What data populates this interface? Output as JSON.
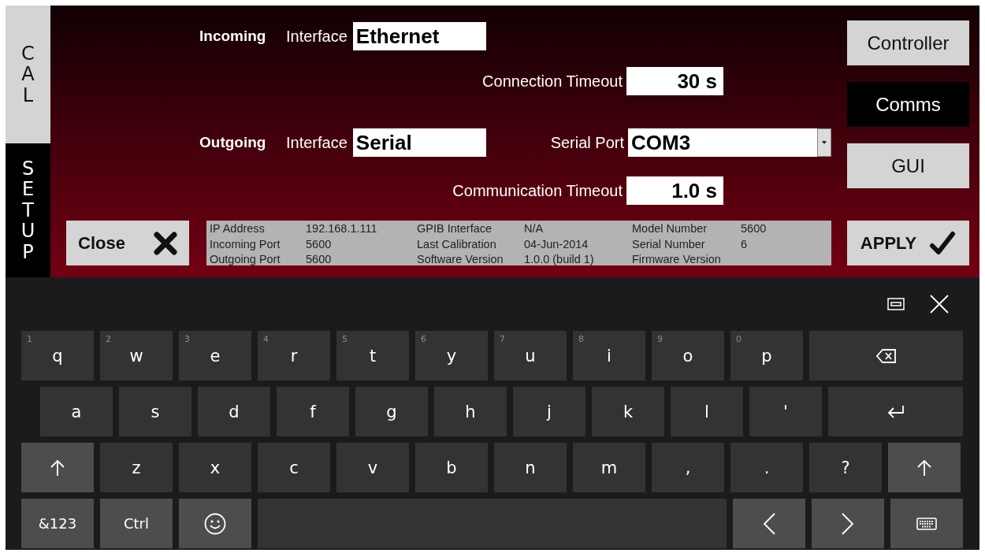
{
  "side_tabs": [
    {
      "label": "CAL",
      "selected": false
    },
    {
      "label": "SETUP",
      "selected": true
    }
  ],
  "incoming": {
    "heading": "Incoming",
    "interface_label": "Interface",
    "interface": "Ethernet",
    "timeout_label": "Connection Timeout",
    "timeout": "30 s"
  },
  "outgoing": {
    "heading": "Outgoing",
    "interface_label": "Interface",
    "interface": "Serial",
    "port_label": "Serial Port",
    "port": "COM3",
    "timeout_label": "Communication Timeout",
    "timeout": "1.0 s"
  },
  "close_button": "Close",
  "info_panel": {
    "rows": [
      [
        {
          "label": "IP Address",
          "value": "192.168.1.111"
        },
        {
          "label": "GPIB Interface",
          "value": "N/A"
        },
        {
          "label": "Model Number",
          "value": "5600"
        }
      ],
      [
        {
          "label": "Incoming Port",
          "value": "5600"
        },
        {
          "label": "Last Calibration",
          "value": "04-Jun-2014"
        },
        {
          "label": "Serial Number",
          "value": "6"
        }
      ],
      [
        {
          "label": "Outgoing Port",
          "value": "5600"
        },
        {
          "label": "Software Version",
          "value": "1.0.0 (build 1)"
        },
        {
          "label": "Firmware Version"
        }
      ]
    ]
  },
  "nav": [
    {
      "label": "Controller",
      "selected": false
    },
    {
      "label": "Comms",
      "selected": true
    },
    {
      "label": "GUI",
      "selected": false
    }
  ],
  "apply_button": "APPLY",
  "keyboard": {
    "rows": [
      [
        {
          "kind": "char",
          "label": "q",
          "hint": "1"
        },
        {
          "kind": "char",
          "label": "w",
          "hint": "2"
        },
        {
          "kind": "char",
          "label": "e",
          "hint": "3"
        },
        {
          "kind": "char",
          "label": "r",
          "hint": "4"
        },
        {
          "kind": "char",
          "label": "t",
          "hint": "5"
        },
        {
          "kind": "char",
          "label": "y",
          "hint": "6"
        },
        {
          "kind": "char",
          "label": "u",
          "hint": "7"
        },
        {
          "kind": "char",
          "label": "i",
          "hint": "8"
        },
        {
          "kind": "char",
          "label": "o",
          "hint": "9"
        },
        {
          "kind": "char",
          "label": "p",
          "hint": "0"
        },
        {
          "kind": "backspace"
        }
      ],
      [
        {
          "kind": "char",
          "label": "a"
        },
        {
          "kind": "char",
          "label": "s"
        },
        {
          "kind": "char",
          "label": "d"
        },
        {
          "kind": "char",
          "label": "f"
        },
        {
          "kind": "char",
          "label": "g"
        },
        {
          "kind": "char",
          "label": "h"
        },
        {
          "kind": "char",
          "label": "j"
        },
        {
          "kind": "char",
          "label": "k"
        },
        {
          "kind": "char",
          "label": "l"
        },
        {
          "kind": "char",
          "label": "'"
        },
        {
          "kind": "enter"
        }
      ],
      [
        {
          "kind": "shift"
        },
        {
          "kind": "char",
          "label": "z"
        },
        {
          "kind": "char",
          "label": "x"
        },
        {
          "kind": "char",
          "label": "c"
        },
        {
          "kind": "char",
          "label": "v"
        },
        {
          "kind": "char",
          "label": "b"
        },
        {
          "kind": "char",
          "label": "n"
        },
        {
          "kind": "char",
          "label": "m"
        },
        {
          "kind": "char",
          "label": ","
        },
        {
          "kind": "char",
          "label": "."
        },
        {
          "kind": "char",
          "label": "?"
        },
        {
          "kind": "shift"
        }
      ],
      [
        {
          "kind": "mode",
          "label": "&123"
        },
        {
          "kind": "mode",
          "label": "Ctrl"
        },
        {
          "kind": "emoji"
        },
        {
          "kind": "space"
        },
        {
          "kind": "left"
        },
        {
          "kind": "right"
        },
        {
          "kind": "keyboard"
        }
      ]
    ]
  }
}
